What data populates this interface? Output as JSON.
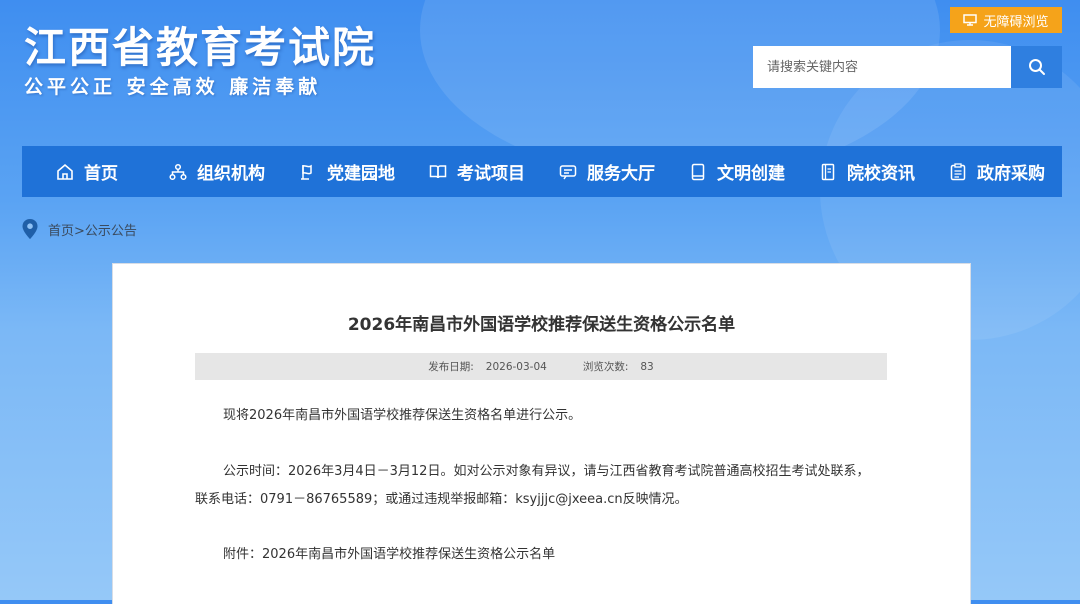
{
  "header": {
    "site_title": "江西省教育考试院",
    "slogan": "公平公正  安全高效  廉洁奉献",
    "accessibility_label": "无障碍浏览",
    "search_placeholder": "请搜索关键内容"
  },
  "nav": {
    "items": [
      {
        "label": "首页",
        "icon": "home-icon"
      },
      {
        "label": "组织机构",
        "icon": "org-chart-icon"
      },
      {
        "label": "党建园地",
        "icon": "party-icon"
      },
      {
        "label": "考试项目",
        "icon": "book-icon"
      },
      {
        "label": "服务大厅",
        "icon": "service-icon"
      },
      {
        "label": "文明创建",
        "icon": "document-icon"
      },
      {
        "label": "院校资讯",
        "icon": "news-icon"
      },
      {
        "label": "政府采购",
        "icon": "clipboard-icon"
      }
    ]
  },
  "breadcrumb": {
    "home": "首页",
    "separator": ">",
    "current": "公示公告"
  },
  "article": {
    "title": "2026年南昌市外国语学校推荐保送生资格公示名单",
    "publish_label": "发布日期:",
    "publish_date": "2026-03-04",
    "views_label": "浏览次数:",
    "views": "83",
    "para1": "现将2026年南昌市外国语学校推荐保送生资格名单进行公示。",
    "para2_line1": "公示时间：2026年3月4日－3月12日。如对公示对象有异议，请与江西省教育考试院普通高校招生考试处联系，",
    "para2_line2": "联系电话：0791－86765589；或通过违规举报邮箱：ksyjjjc@jxeea.cn反映情况。",
    "attachment": "附件：2026年南昌市外国语学校推荐保送生资格公示名单"
  },
  "colors": {
    "nav_bg": "#1f72d8",
    "accent_orange": "#f5a31a",
    "search_btn": "#2f7fe0"
  }
}
